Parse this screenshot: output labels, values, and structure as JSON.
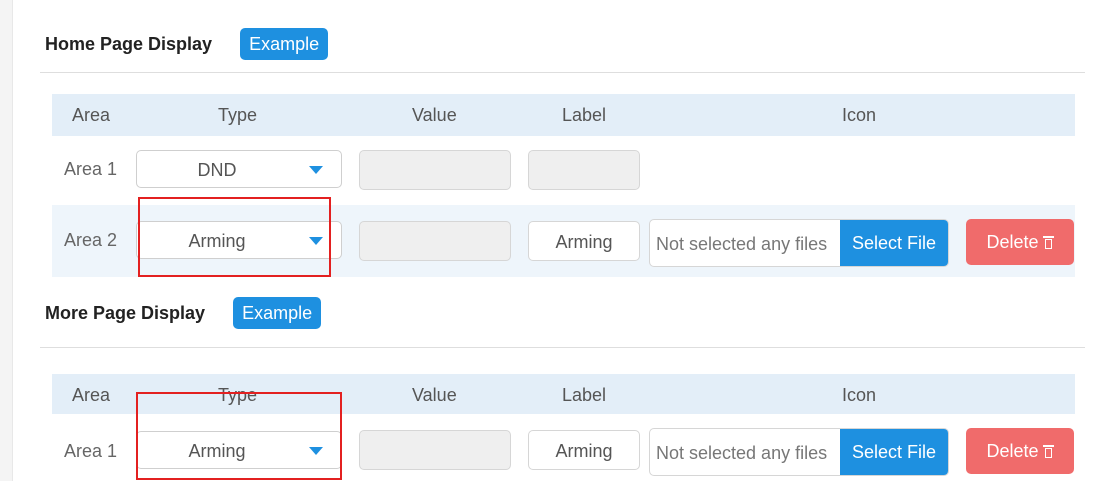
{
  "sections": [
    {
      "title": "Home Page Display",
      "example_label": "Example",
      "headers": {
        "area": "Area",
        "type": "Type",
        "value": "Value",
        "label": "Label",
        "icon": "Icon"
      },
      "rows": [
        {
          "area": "Area 1",
          "type": "DND",
          "value": "",
          "label": ""
        },
        {
          "area": "Area 2",
          "type": "Arming",
          "value": "",
          "label": "Arming",
          "file_text": "Not selected any files",
          "select_file": "Select File",
          "delete": "Delete"
        }
      ]
    },
    {
      "title": "More Page Display",
      "example_label": "Example",
      "headers": {
        "area": "Area",
        "type": "Type",
        "value": "Value",
        "label": "Label",
        "icon": "Icon"
      },
      "rows": [
        {
          "area": "Area 1",
          "type": "Arming",
          "value": "",
          "label": "Arming",
          "file_text": "Not selected any files",
          "select_file": "Select File",
          "delete": "Delete"
        }
      ]
    }
  ],
  "colors": {
    "accent": "#1e90e0",
    "danger": "#f06b6b",
    "header_bg": "#e3eef8",
    "highlight": "#e32020"
  }
}
